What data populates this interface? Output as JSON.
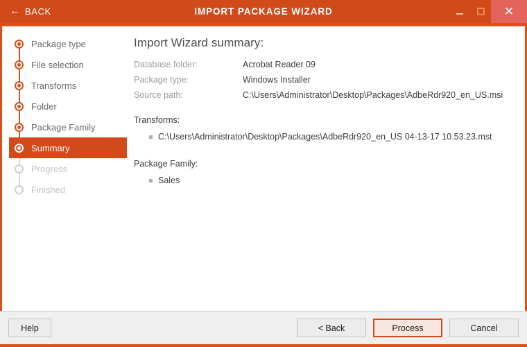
{
  "window": {
    "back_label": "BACK",
    "back_icon": "arrow-left-icon",
    "title": "IMPORT PACKAGE WIZARD",
    "controls": {
      "minimize": "minimize-icon",
      "maximize": "maximize-icon",
      "close": "✕"
    },
    "accent_color": "#d2491a",
    "accent_border_color": "#d9501a",
    "close_button_color": "#e3645a"
  },
  "sidebar": {
    "steps": [
      {
        "label": "Package type",
        "state": "completed"
      },
      {
        "label": "File selection",
        "state": "completed"
      },
      {
        "label": "Transforms",
        "state": "completed"
      },
      {
        "label": "Folder",
        "state": "completed"
      },
      {
        "label": "Package Family",
        "state": "completed"
      },
      {
        "label": "Summary",
        "state": "active"
      },
      {
        "label": "Progress",
        "state": "disabled"
      },
      {
        "label": "Finished",
        "state": "disabled"
      }
    ]
  },
  "content": {
    "title": "Import Wizard summary:",
    "fields": [
      {
        "label": "Database folder:",
        "value": "Acrobat Reader 09"
      },
      {
        "label": "Package type:",
        "value": "Windows Installer"
      },
      {
        "label": "Source path:",
        "value": "C:\\Users\\Administrator\\Desktop\\Packages\\AdbeRdr920_en_US.msi"
      }
    ],
    "transforms": {
      "title": "Transforms:",
      "items": [
        "C:\\Users\\Administrator\\Desktop\\Packages\\AdbeRdr920_en_US 04-13-17 10.53.23.mst"
      ]
    },
    "package_family": {
      "title": "Package Family:",
      "items": [
        "Sales"
      ]
    }
  },
  "footer": {
    "help_label": "Help",
    "back_label": "< Back",
    "process_label": "Process",
    "cancel_label": "Cancel"
  }
}
